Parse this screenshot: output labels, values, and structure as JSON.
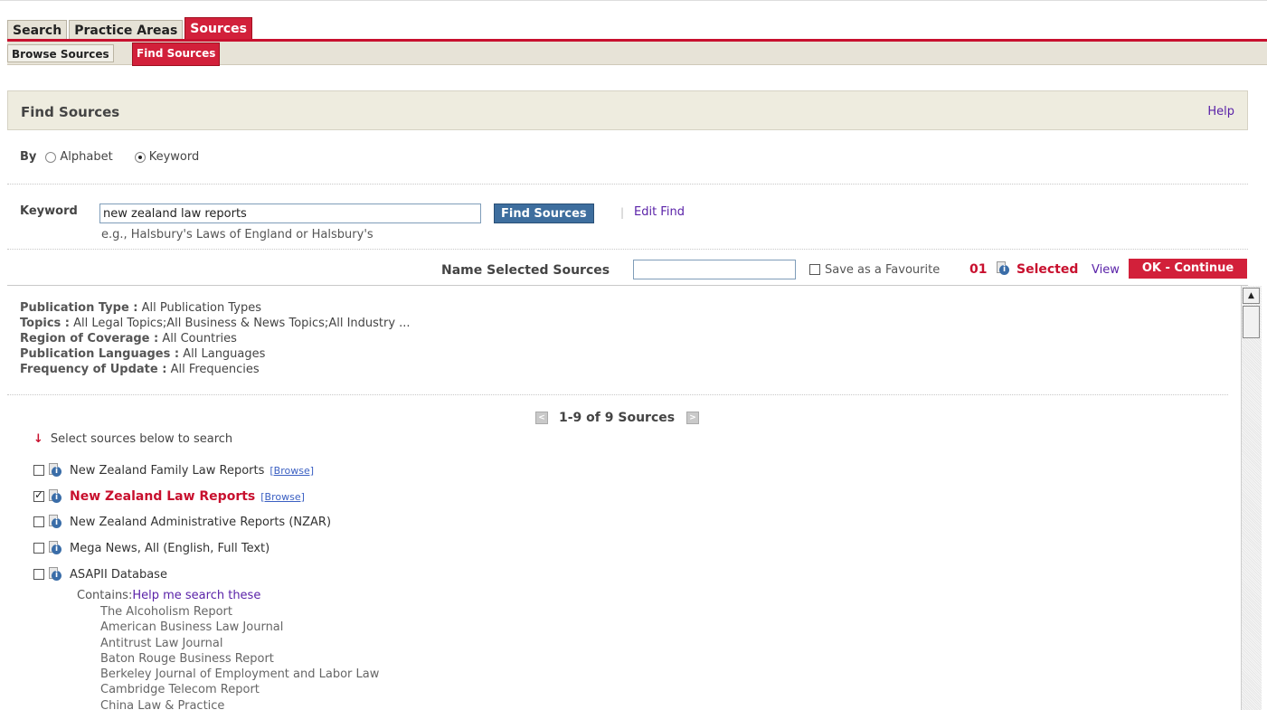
{
  "tabs": [
    {
      "label": "Search"
    },
    {
      "label": "Practice Areas"
    },
    {
      "label": "Sources"
    }
  ],
  "subtabs": [
    {
      "label": "Browse Sources"
    },
    {
      "label": "Find Sources"
    }
  ],
  "header": {
    "title": "Find Sources",
    "help": "Help"
  },
  "by": {
    "label": "By",
    "option_alphabet": "Alphabet",
    "option_keyword": "Keyword",
    "selected": "Keyword"
  },
  "keyword": {
    "label": "Keyword",
    "value": "new zealand law reports",
    "hint": "e.g., Halsbury's Laws of England or Halsbury's",
    "find_button": "Find Sources",
    "separator": "|",
    "edit_find": "Edit Find"
  },
  "name_bar": {
    "label": "Name Selected Sources",
    "favourite_label": "Save as a Favourite",
    "count": "01",
    "selected_label": "Selected",
    "view": "View",
    "ok_button": "OK - Continue"
  },
  "filters": [
    {
      "key": "Publication Type :",
      "value": "All Publication Types"
    },
    {
      "key": "Topics :",
      "value": "All Legal Topics;All Business & News Topics;All Industry ..."
    },
    {
      "key": "Region of Coverage :",
      "value": "All Countries"
    },
    {
      "key": "Publication Languages :",
      "value": "All Languages"
    },
    {
      "key": "Frequency of Update :",
      "value": "All Frequencies"
    }
  ],
  "pager": {
    "text": "1-9 of 9 Sources",
    "prev": "<",
    "next": ">"
  },
  "select_hint": "Select sources below to search",
  "select_hint_icon": "down-arrow-icon",
  "sources": [
    {
      "name": "New Zealand Family Law Reports",
      "browse": "[Browse]",
      "checked": false
    },
    {
      "name": "New Zealand Law Reports",
      "browse": "[Browse]",
      "checked": true
    },
    {
      "name": "New Zealand Administrative Reports (NZAR)",
      "browse": "",
      "checked": false
    },
    {
      "name": "Mega News, All (English, Full Text)",
      "browse": "",
      "checked": false
    },
    {
      "name": "ASAPII Database",
      "browse": "",
      "checked": false
    }
  ],
  "contains": {
    "label": "Contains:",
    "help": "Help me search these",
    "items": [
      "The Alcoholism Report",
      "American Business Law Journal",
      "Antitrust Law Journal",
      "Baton Rouge Business Report",
      "Berkeley Journal of Employment and Labor Law",
      "Cambridge Telecom Report",
      "China Law & Practice"
    ]
  },
  "colors": {
    "accent": "#c8102e",
    "link": "#5a22a8",
    "button_blue": "#3e6e9e"
  },
  "icons": {
    "source_info": "info-icon",
    "scroll_up": "scroll-up-arrow-icon"
  }
}
